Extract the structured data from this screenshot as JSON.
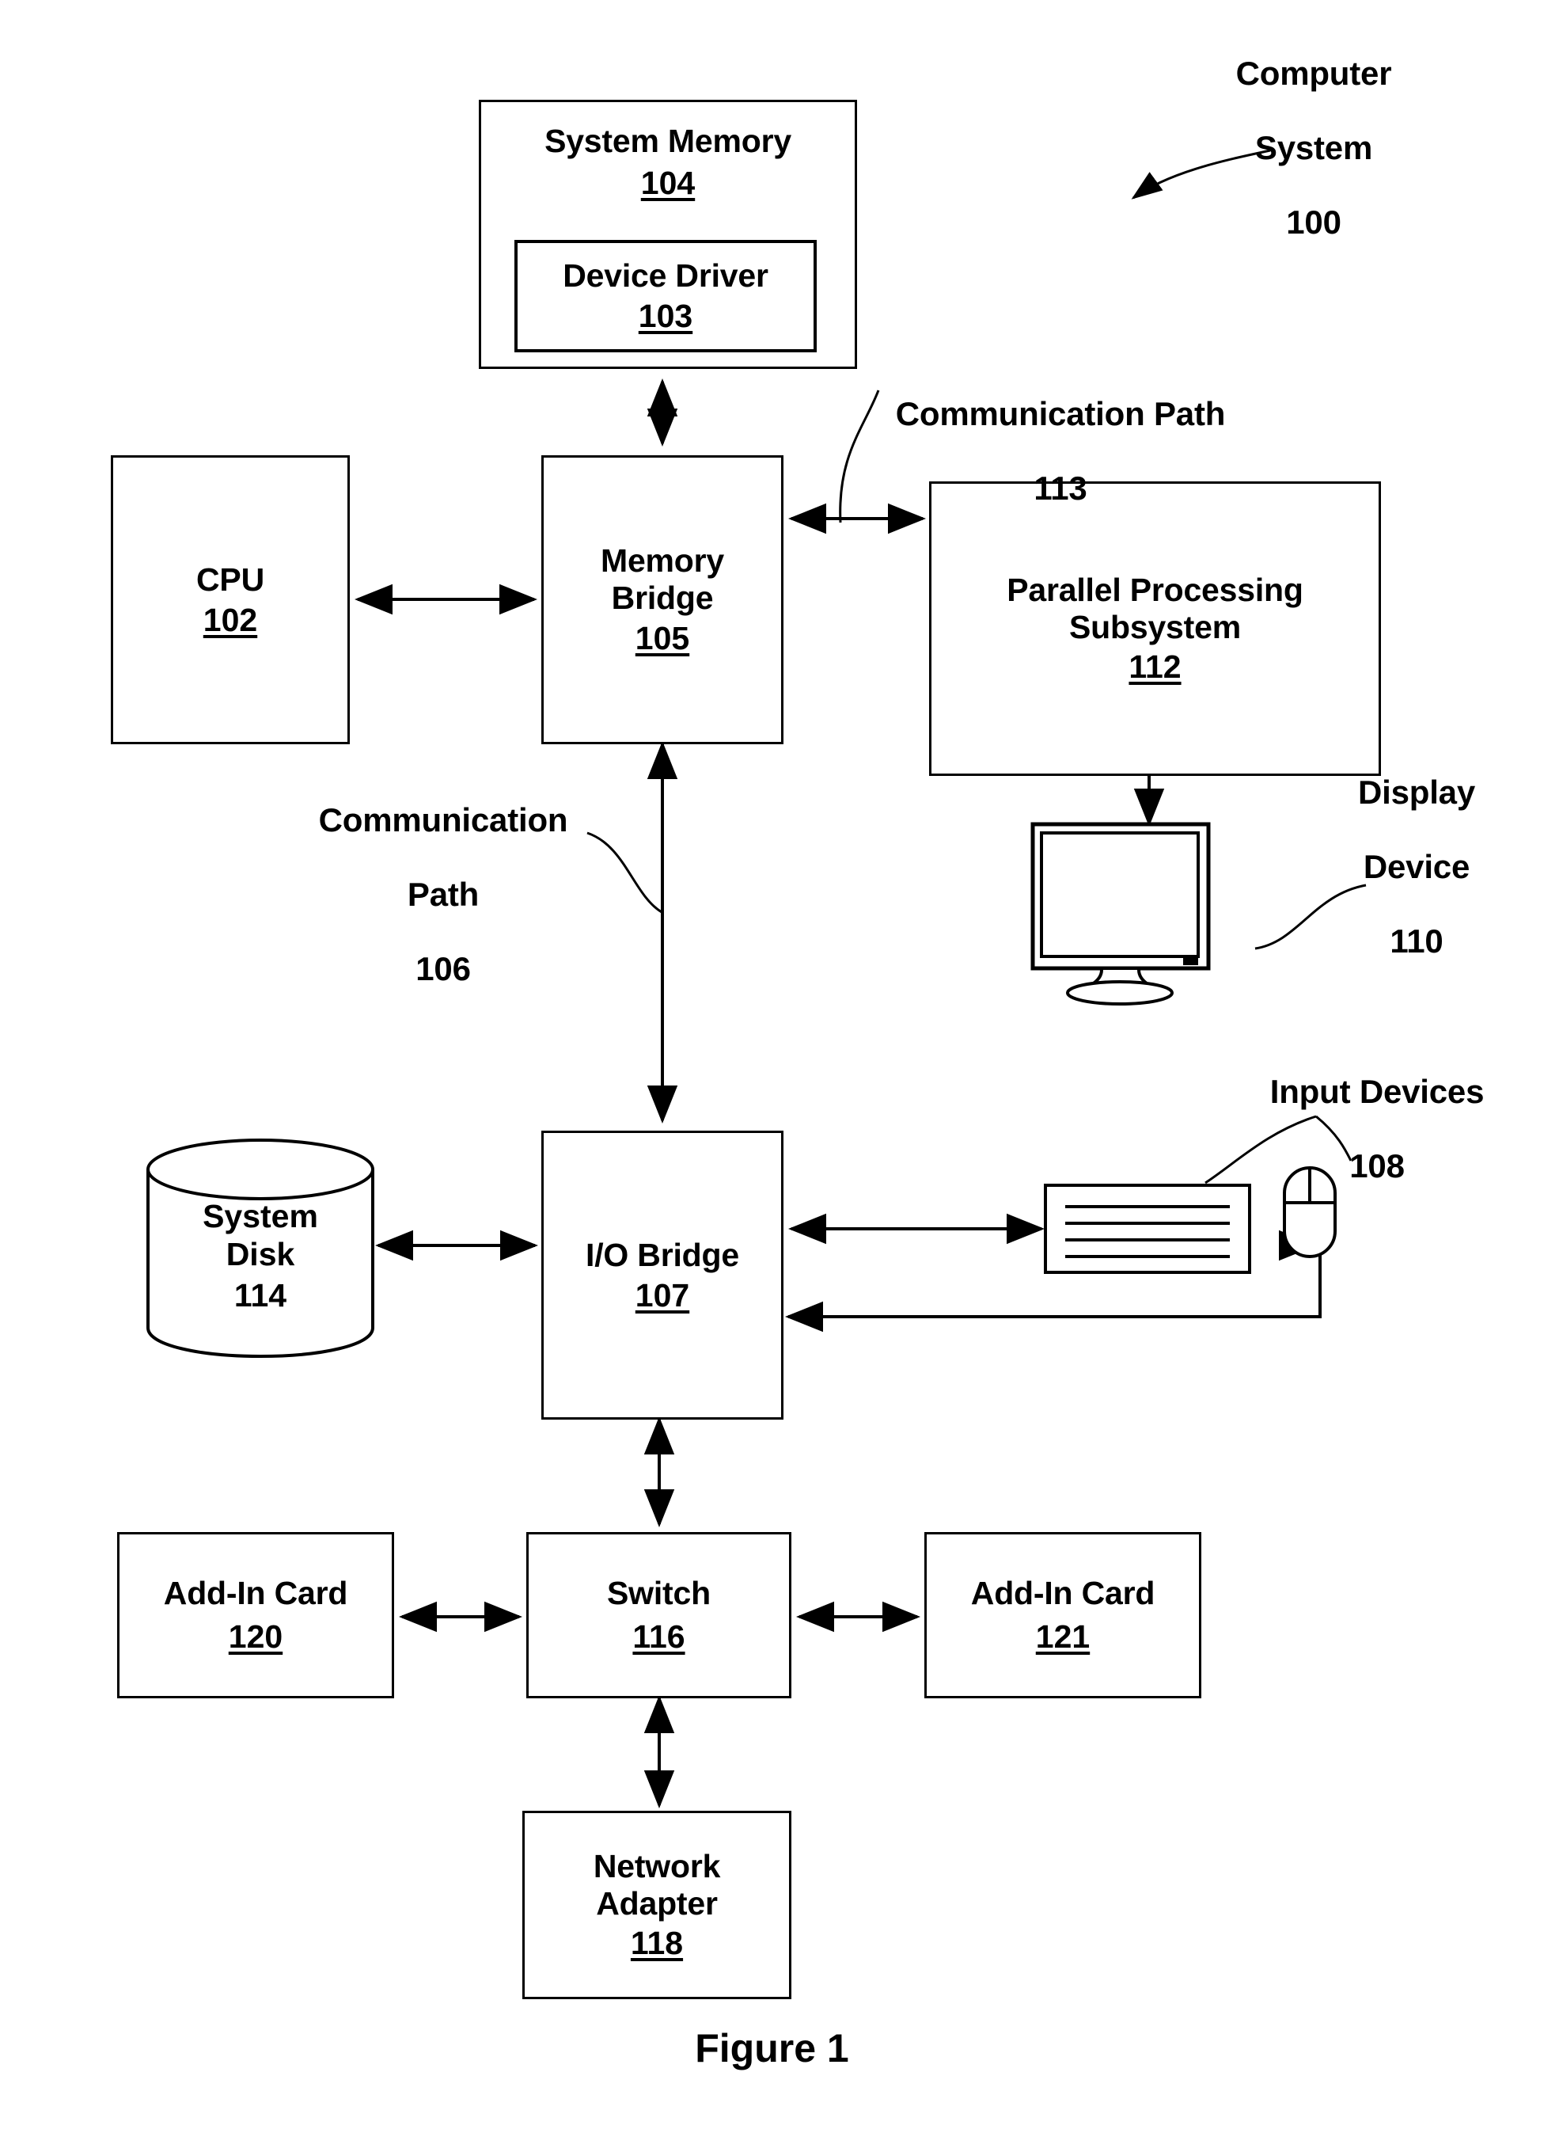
{
  "figure": {
    "caption": "Figure 1",
    "system_label": {
      "line1": "Computer",
      "line2": "System",
      "number": "100"
    }
  },
  "blocks": {
    "system_memory": {
      "title": "System Memory",
      "number": "104"
    },
    "device_driver": {
      "title": "Device Driver",
      "number": "103"
    },
    "cpu": {
      "title": "CPU",
      "number": "102"
    },
    "memory_bridge": {
      "title_line1": "Memory",
      "title_line2": "Bridge",
      "number": "105"
    },
    "parallel_processing_subsystem": {
      "title_line1": "Parallel Processing",
      "title_line2": "Subsystem",
      "number": "112"
    },
    "io_bridge": {
      "title": "I/O Bridge",
      "number": "107"
    },
    "system_disk": {
      "title_line1": "System",
      "title_line2": "Disk",
      "number": "114"
    },
    "switch": {
      "title": "Switch",
      "number": "116"
    },
    "add_in_card_120": {
      "title": "Add-In Card",
      "number": "120"
    },
    "add_in_card_121": {
      "title": "Add-In Card",
      "number": "121"
    },
    "network_adapter": {
      "title_line1": "Network",
      "title_line2": "Adapter",
      "number": "118"
    }
  },
  "callouts": {
    "communication_path_113": {
      "line1": "Communication Path",
      "number": "113"
    },
    "communication_path_106": {
      "line1": "Communication",
      "line2": "Path",
      "number": "106"
    },
    "display_device": {
      "line1": "Display",
      "line2": "Device",
      "number": "110"
    },
    "input_devices": {
      "line1": "Input Devices",
      "number": "108"
    }
  },
  "icons": {
    "display_device": "monitor-icon",
    "keyboard": "keyboard-icon",
    "mouse": "mouse-icon",
    "system_disk": "cylinder-database-icon"
  },
  "style": {
    "stroke": "#000000",
    "background": "#ffffff"
  }
}
